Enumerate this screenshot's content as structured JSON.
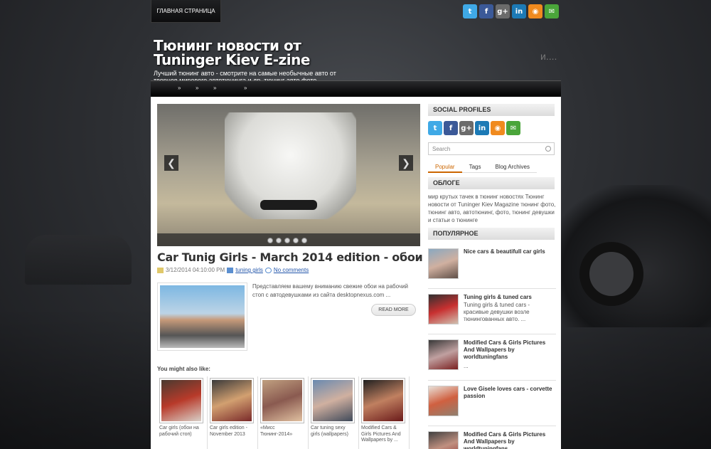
{
  "nav": {
    "home": "ГЛАВНАЯ СТРАНИЦА",
    "menu_separators": [
      "»",
      "»",
      "»",
      "»"
    ]
  },
  "social_icons": [
    "twitter-icon",
    "facebook-icon",
    "google-plus-icon",
    "linkedin-icon",
    "rss-icon",
    "email-icon"
  ],
  "social_glyphs": [
    "t",
    "f",
    "g+",
    "in",
    "◉",
    "✉"
  ],
  "header": {
    "title": "Тюнинг новости от Tuninger Kiev E-zine",
    "description": "Лучший тюнинг авто - смотрите на самые необычные авто от творцов мирового автотюнинга и др. тюнинг авто фото",
    "ticker": "и...."
  },
  "slider": {
    "prev": "❮",
    "next": "❯",
    "dots": 5
  },
  "post": {
    "title": "Car Tunig Girls - March 2014 edition - обои",
    "date": "3/12/2014 04:10:00 PM",
    "label": "tuning girls",
    "comments": "No comments",
    "excerpt": "Представляем вашему вниманию  свежие обои на рабочий стоп с автодевушками из сайта desktopnexus.com ...",
    "read_more": "READ MORE"
  },
  "related": {
    "title": "You might also like:",
    "items": [
      {
        "text": "Car girls (обои на рабочий стоп)",
        "colors": [
          "#4a3a30",
          "#b83a2a",
          "#d8d0c8"
        ]
      },
      {
        "text": "Car girls edition - November 2013",
        "colors": [
          "#3a3a3a",
          "#d2a070",
          "#7a2a2a"
        ]
      },
      {
        "text": "«Мисс Тюнинг-2014»",
        "colors": [
          "#c0a080",
          "#8a5a50",
          "#e0c0a0"
        ]
      },
      {
        "text": "Car tuning sexy girls (wallpapers)",
        "colors": [
          "#6a8ab0",
          "#d0b0a0",
          "#404a5a"
        ]
      },
      {
        "text": "Modified Cars & Girls Pictures And Wallpapers by ...",
        "colors": [
          "#202020",
          "#c08060",
          "#6a1a1a"
        ]
      }
    ]
  },
  "sidebar": {
    "social_title": "Social Profiles",
    "search_placeholder": "Search",
    "tabs": [
      "Popular",
      "Tags",
      "Blog Archives"
    ],
    "about_title": "Облоге",
    "about_text": "мир крутых тачек в тюнинг новостях Тюнинг новости от Tuninger Kiev Magazine тюнинг фото, тюнинг авто, автотюнинг, фото, тюнинг девушки и статьи о тюнинге",
    "popular_title": "Популярное",
    "popular": [
      {
        "title": "Nice cars & beautifull car girls",
        "desc": "",
        "colors": [
          "#8aa8c0",
          "#d0b0a0",
          "#605048"
        ]
      },
      {
        "title": "Tuning girls & tuned cars",
        "desc": "Tuning girls & tuned cars - красивые девушки возле тюнингованных авто. ...",
        "colors": [
          "#303030",
          "#c83030",
          "#d0c0b0"
        ]
      },
      {
        "title": "Modified Cars & Girls Pictures And Wallpapers by worldtuningfans",
        "desc": "...",
        "colors": [
          "#383838",
          "#c0a0a0",
          "#7a2020"
        ]
      },
      {
        "title": "Love Gisele loves cars - corvette passion",
        "desc": "",
        "colors": [
          "#e8e0d8",
          "#d06040",
          "#908070"
        ]
      },
      {
        "title": "Modified Cars & Girls Pictures And Wallpapers by worldtuningfans",
        "desc": "",
        "colors": [
          "#404040",
          "#c09080",
          "#903030"
        ]
      }
    ]
  }
}
